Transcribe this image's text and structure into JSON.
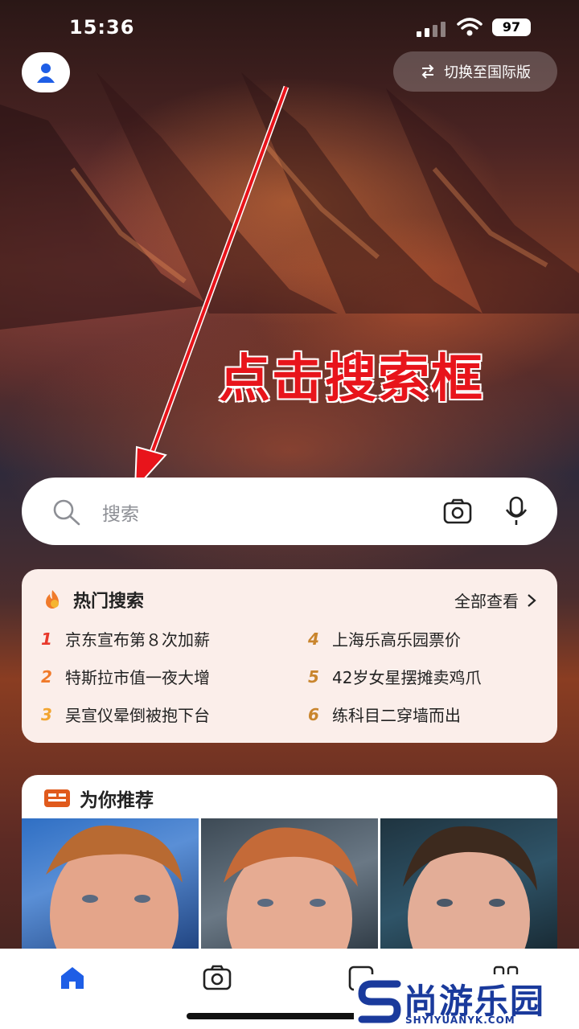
{
  "status": {
    "time": "15:36",
    "battery": "97"
  },
  "header": {
    "switch_label": "切换至国际版"
  },
  "overlay": {
    "caption": "点击搜索框"
  },
  "search": {
    "placeholder": "搜索"
  },
  "hot": {
    "title": "热门搜索",
    "view_all": "全部查看",
    "items": [
      {
        "rank": "1",
        "text": "京东宣布第８次加薪",
        "color": "#e8382b"
      },
      {
        "rank": "2",
        "text": "特斯拉市值一夜大增",
        "color": "#f07a2a"
      },
      {
        "rank": "3",
        "text": "吴宣仪晕倒被抱下台",
        "color": "#f2a531"
      },
      {
        "rank": "4",
        "text": "上海乐高乐园票价",
        "color": "#c9852d"
      },
      {
        "rank": "5",
        "text": "42岁女星摆摊卖鸡爪",
        "color": "#c9852d"
      },
      {
        "rank": "6",
        "text": "练科目二穿墙而出",
        "color": "#c9852d"
      }
    ]
  },
  "recommend": {
    "title": "为你推荐"
  },
  "watermark": {
    "main": "尚游乐园",
    "sub": "SHYIYUANYK.COM"
  },
  "colors": {
    "accent": "#1e5ee6",
    "overlay_red": "#e8141b"
  }
}
